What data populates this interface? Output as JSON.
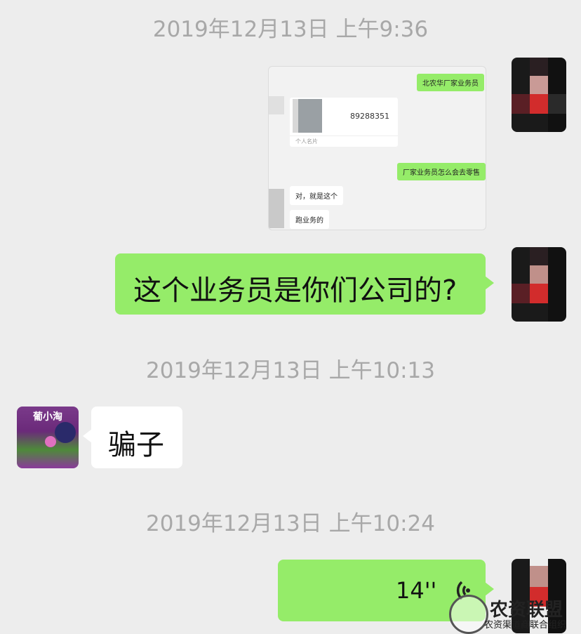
{
  "timestamps": [
    "2019年12月13日 上午9:36",
    "2019年12月13日 上午10:13",
    "2019年12月13日 上午10:24"
  ],
  "screenshot_msg": {
    "bubble1": "北农华厂家业务员",
    "card_phone": "89288351",
    "card_label": "个人名片",
    "bubble2": "厂家业务员怎么会去零售",
    "reply1": "对，就是这个",
    "reply2": "跑业务的"
  },
  "messages": {
    "question": "这个业务员是你们公司的?",
    "reply": "骗子",
    "voice_duration": "14''"
  },
  "contact_avatar": {
    "text": "葡小淘"
  },
  "watermark": {
    "title": "农资联盟",
    "subtitle": "农资渠道商联合组织"
  },
  "colors": {
    "accent_green": "#95ec69",
    "bg": "#ededed",
    "timestamp": "#a8a8a8"
  }
}
